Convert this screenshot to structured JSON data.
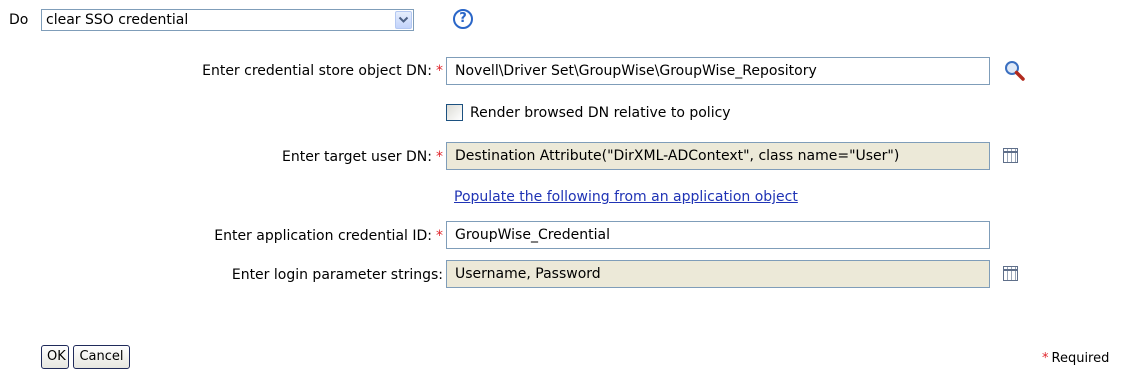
{
  "action": {
    "do_label": "Do",
    "selected": "clear SSO credential"
  },
  "help": {
    "glyph": "?"
  },
  "credential_store": {
    "label": "Enter credential store object DN:",
    "required_marker": "*",
    "value": "Novell\\Driver Set\\GroupWise\\GroupWise_Repository"
  },
  "render_relative": {
    "label": "Render browsed DN relative to policy",
    "checked": false
  },
  "target_user": {
    "label": "Enter target user DN:",
    "required_marker": "*",
    "value": "Destination Attribute(\"DirXML-ADContext\", class name=\"User\")"
  },
  "populate_link": "Populate the following from an application object",
  "app_credential_id": {
    "label": "Enter application credential ID:",
    "required_marker": "*",
    "value": "GroupWise_Credential"
  },
  "login_params": {
    "label": "Enter login parameter strings:",
    "value": "Username, Password"
  },
  "buttons": {
    "ok": "OK",
    "cancel": "Cancel"
  },
  "required_note": {
    "marker": "*",
    "text": "Required"
  },
  "colors": {
    "required": "#e0242a",
    "link": "#1f33b5",
    "readonly_field": "#ece9d8",
    "field_border": "#7f9db9"
  },
  "icons": [
    "chevron-down-icon",
    "help-icon",
    "magnifier-icon",
    "argument-builder-icon"
  ]
}
